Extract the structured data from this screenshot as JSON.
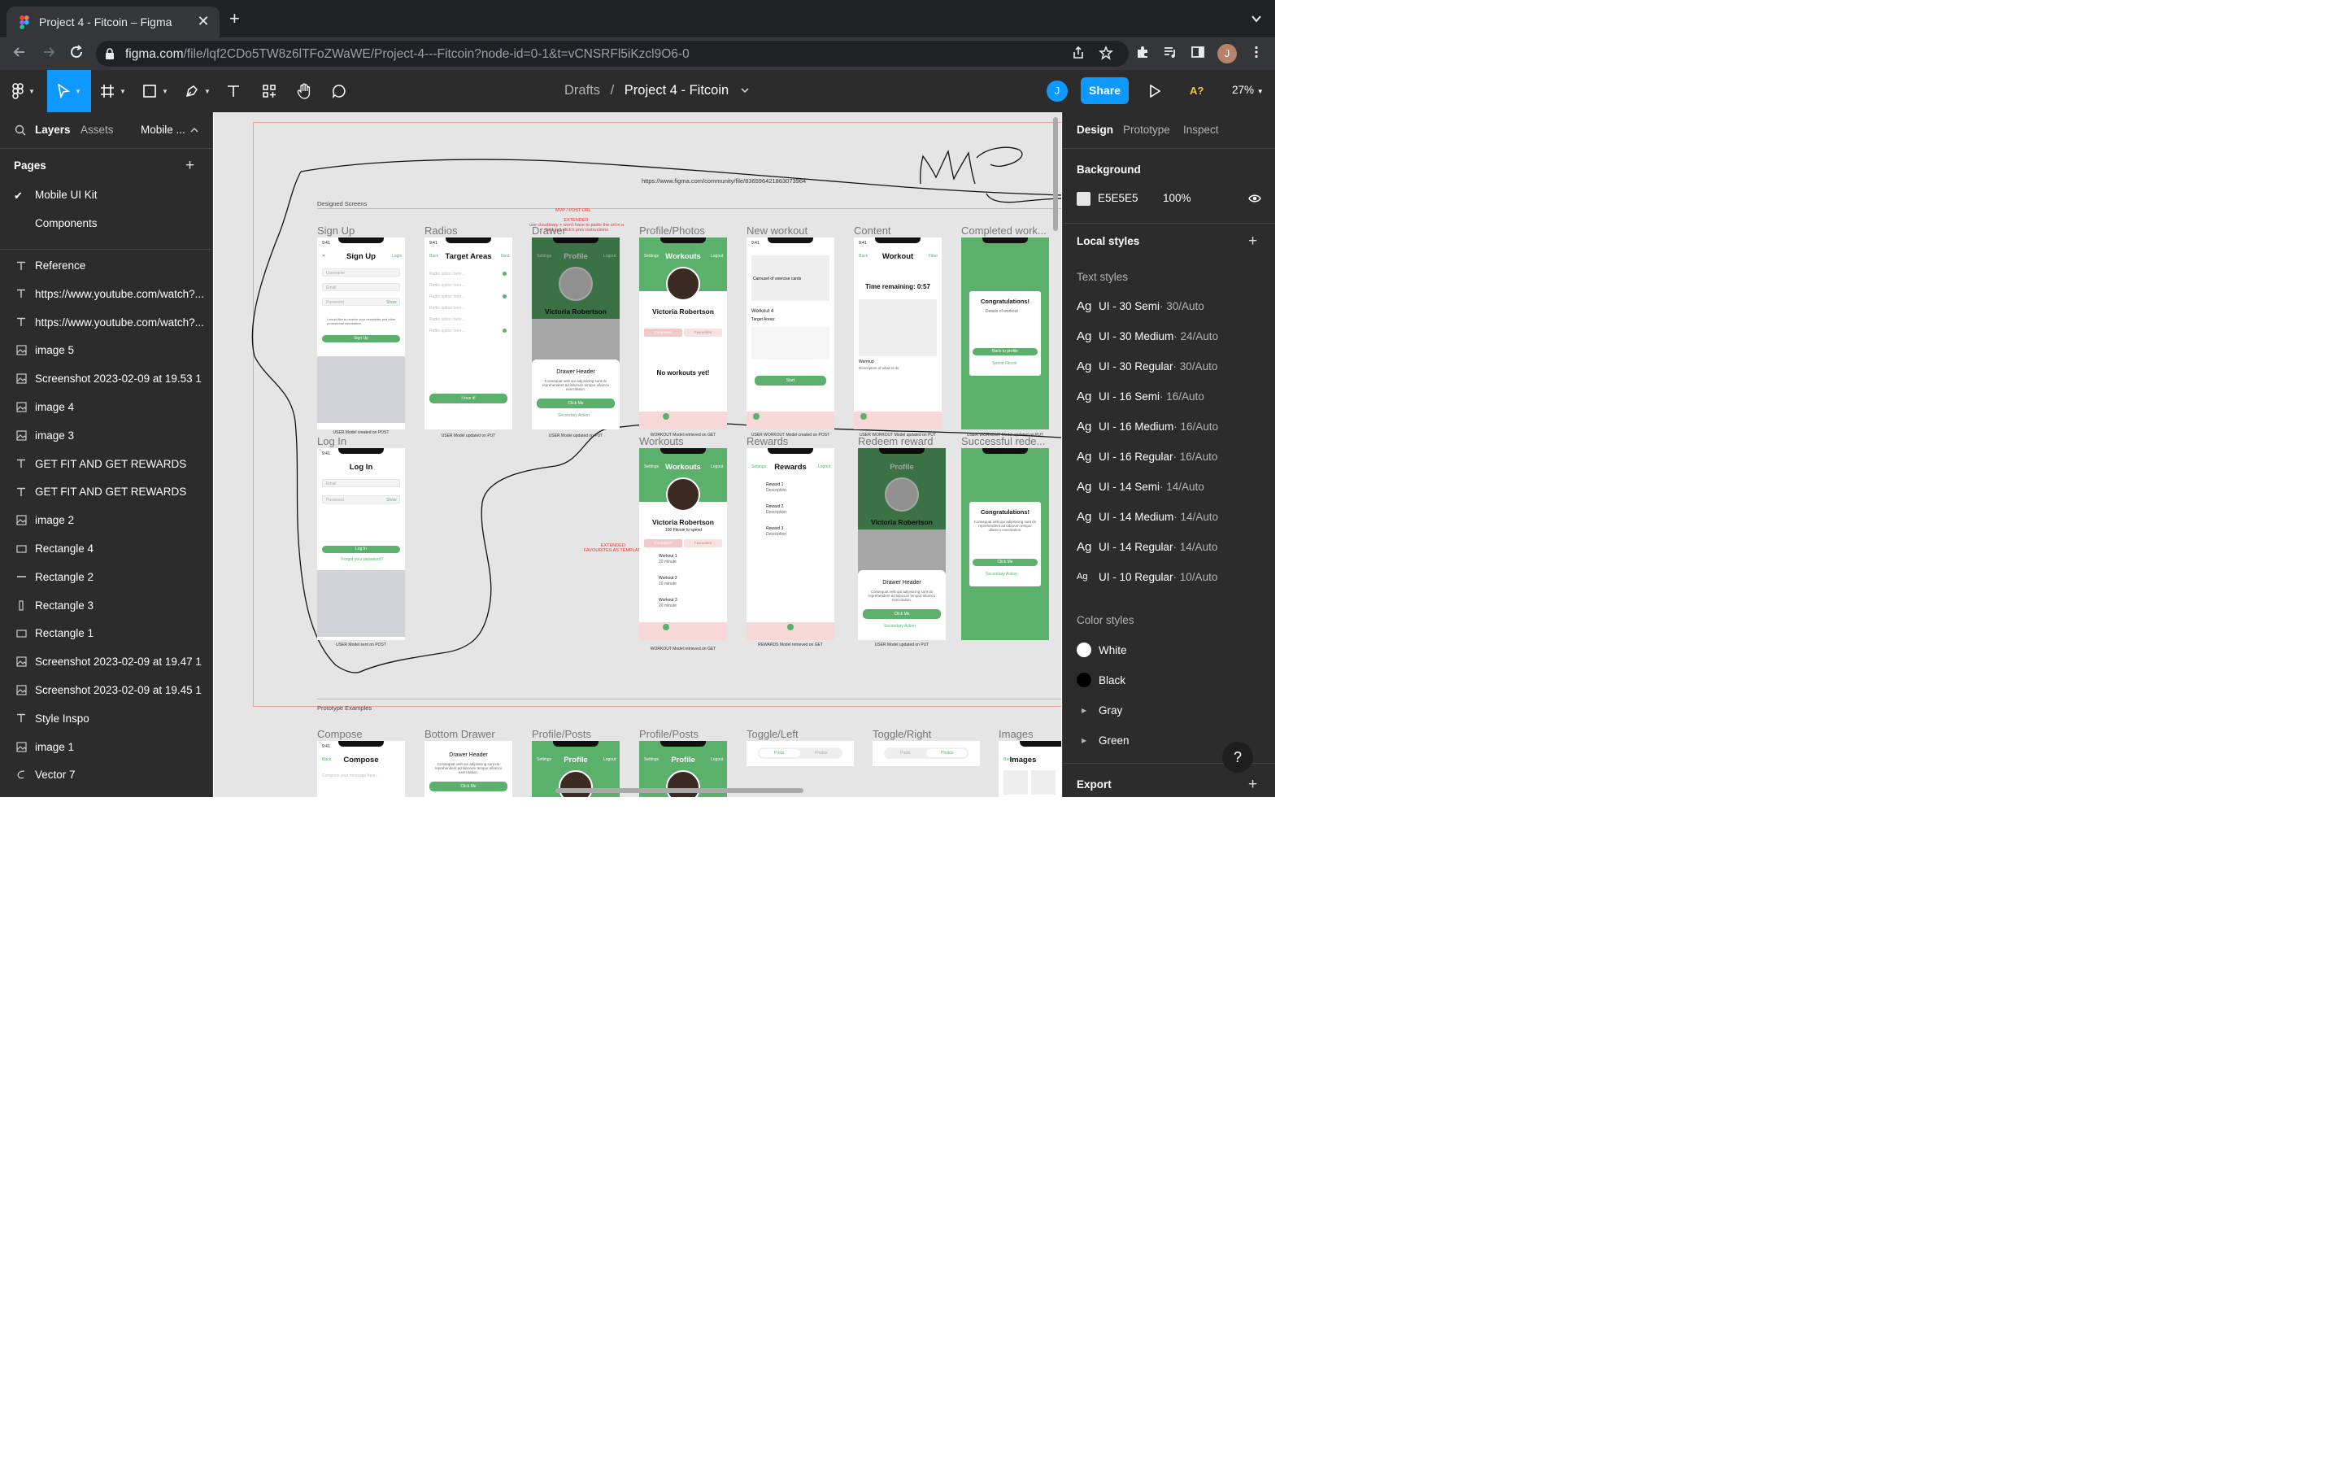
{
  "browser": {
    "tab_title": "Project 4 - Fitcoin – Figma",
    "tab_close": "✕",
    "new_tab": "+",
    "url_host": "figma.com",
    "url_path": "/file/lqf2CDo5TW8z6lTFoZWaWE/Project-4---Fitcoin?node-id=0-1&t=vCNSRFl5iKzcl9O6-0",
    "profile_initial": "J"
  },
  "toolbar": {
    "breadcrumb_drafts": "Drafts",
    "breadcrumb_sep": "/",
    "project_name": "Project 4 - Fitcoin",
    "user_initial": "J",
    "share_label": "Share",
    "a11y_label": "A?",
    "zoom_level": "27%"
  },
  "left_panel": {
    "tabs": [
      "Layers",
      "Assets",
      "Mobile ..."
    ],
    "pages_heading": "Pages",
    "pages": [
      "Mobile UI Kit",
      "Components"
    ],
    "layers": [
      {
        "icon": "text",
        "name": "Reference"
      },
      {
        "icon": "text",
        "name": "https://www.youtube.com/watch?..."
      },
      {
        "icon": "text",
        "name": "https://www.youtube.com/watch?..."
      },
      {
        "icon": "image",
        "name": "image 5"
      },
      {
        "icon": "image",
        "name": "Screenshot 2023-02-09 at 19.53 1"
      },
      {
        "icon": "image",
        "name": "image 4"
      },
      {
        "icon": "image",
        "name": "image 3"
      },
      {
        "icon": "text",
        "name": "GET FIT AND GET REWARDS"
      },
      {
        "icon": "text",
        "name": "GET FIT AND GET REWARDS"
      },
      {
        "icon": "image",
        "name": "image 2"
      },
      {
        "icon": "rect",
        "name": "Rectangle 4"
      },
      {
        "icon": "line",
        "name": "Rectangle 2"
      },
      {
        "icon": "vrect",
        "name": "Rectangle 3"
      },
      {
        "icon": "rect",
        "name": "Rectangle 1"
      },
      {
        "icon": "image",
        "name": "Screenshot 2023-02-09 at 19.47 1"
      },
      {
        "icon": "image",
        "name": "Screenshot 2023-02-09 at 19.45 1"
      },
      {
        "icon": "text",
        "name": "Style Inspo"
      },
      {
        "icon": "image",
        "name": "image 1"
      },
      {
        "icon": "vector",
        "name": "Vector 7"
      }
    ]
  },
  "canvas": {
    "mvp_scribble": "MVP",
    "community_url": "https://www.figma.com/community/file/836596421863073964",
    "designed_screens": "Designed Screens",
    "prototype_examples": "Prototype Examples",
    "red_note_1": "MVP / POST URL",
    "red_note_2": "EXTENDED:\nuse cloudinary + won't have to paste the url in a\nfield just click's prev instructions",
    "red_note_3": "EXTENDED:\nFAVOURITES AS TEMPLATE",
    "row1_labels": [
      "Sign Up",
      "Radios",
      "Drawer",
      "Profile/Photos",
      "New workout",
      "Content",
      "Completed work..."
    ],
    "row2_labels": [
      "Log In",
      "Workouts",
      "Rewards",
      "Redeem reward",
      "Successful rede..."
    ],
    "row3_labels": [
      "Compose",
      "Bottom Drawer",
      "Profile/Posts",
      "Profile/Posts",
      "Toggle/Left",
      "Toggle/Right",
      "Images"
    ],
    "captions": {
      "signup": "USER Model created on POST",
      "radios": "USER Model updated on PUT",
      "drawer": "USER Model updated on PUT",
      "profile": "WORKOUT Model retrieved on GET",
      "newworkout": "USER WORKOUT Model created on POST",
      "content": "USER WORKOUT Model updated on PUT",
      "completed": "USER WORKOUT Model updated on PUT",
      "login": "USER Model sent on POST",
      "workouts": "WORKOUT Model retrieved on GET",
      "rewards": "REWARDS Model retrieved on GET",
      "redeem": "USER Model updated on PUT"
    },
    "screens": {
      "status_time": "9:41",
      "signup_title": "Sign Up",
      "signup_login": "Login",
      "signup_fields": [
        "Username",
        "Email",
        "Password"
      ],
      "signup_show": "Show",
      "signup_check": "I would like to receive your newsletter and other promotional information.",
      "signup_btn": "Sign Up",
      "radios_title": "Target Areas",
      "radios_back": "Back",
      "radios_next": "Next",
      "radio_option": "Radio option here...",
      "radios_btn": "I love it!",
      "profile_title": "Profile",
      "settings": "Settings",
      "logout": "Logout",
      "person_name": "Victoria Robertson",
      "drawer_header": "Drawer Header",
      "drawer_text": "Consequat velit qui adipisicing sunt do reprehenderit ad laborum tempor ullamco exercitation.",
      "click_me": "Click Me",
      "secondary_action": "Secondary Action",
      "workouts_title": "Workouts",
      "completed_tab": "Completed",
      "favourites_tab": "Favourites",
      "no_workouts": "No workouts yet!",
      "carousel": "Carousel of exercise cards",
      "workout_4": "Workout 4",
      "target_areas": "Target Areas:",
      "start": "Start",
      "content_title": "Workout",
      "content_back": "Back",
      "content_filter": "Filter",
      "time_remaining": "Time remaining: 0:57",
      "warmup": "Warmup",
      "warmup_desc": "Description of what to do",
      "congrats": "Congratulations!",
      "details": "Details of workout",
      "back_to_profile": "Back to profile",
      "spend_fitcoin": "Spend Fitcoin",
      "login_title": "Log In",
      "login_fields": [
        "Email",
        "Password"
      ],
      "login_btn": "Log In",
      "forgot": "Forgot your password?",
      "fitcoin_spend": "100 Fitcoin to spend",
      "workout_items": [
        "Workout 1",
        "Workout 2",
        "Workout 3"
      ],
      "workout_mins": [
        "20 minute",
        "10 minute",
        "20 minute"
      ],
      "rewards_title": "Rewards",
      "reward_items": [
        "Reward 1",
        "Reward 2",
        "Reward 3"
      ],
      "reward_desc": "Description",
      "reward_cost": "50 Fitcoin",
      "compose_title": "Compose",
      "compose_back": "Back",
      "compose_placeholder": "Compose your message here...",
      "images_title": "Images",
      "toggle_posts": "Posts",
      "toggle_photos": "Photos"
    }
  },
  "right_panel": {
    "tabs": [
      "Design",
      "Prototype",
      "Inspect"
    ],
    "background_heading": "Background",
    "bg_hex": "E5E5E5",
    "bg_opacity": "100%",
    "local_styles": "Local styles",
    "text_styles_heading": "Text styles",
    "ag": "Ag",
    "text_styles": [
      {
        "name": "UI - 30 Semi",
        "meta": " · 30/Auto"
      },
      {
        "name": "UI - 30 Medium",
        "meta": " · 24/Auto"
      },
      {
        "name": "UI - 30 Regular",
        "meta": " · 30/Auto"
      },
      {
        "name": "UI - 16 Semi",
        "meta": " · 16/Auto"
      },
      {
        "name": "UI - 16 Medium",
        "meta": " · 16/Auto"
      },
      {
        "name": "UI - 16 Regular",
        "meta": " · 16/Auto"
      },
      {
        "name": "UI - 14 Semi",
        "meta": " · 14/Auto"
      },
      {
        "name": "UI - 14 Medium",
        "meta": " · 14/Auto"
      },
      {
        "name": "UI - 14 Regular",
        "meta": " · 14/Auto"
      },
      {
        "name": "UI - 10 Regular",
        "meta": " · 10/Auto"
      }
    ],
    "color_styles_heading": "Color styles",
    "color_styles": [
      {
        "name": "White",
        "hex": "#ffffff"
      },
      {
        "name": "Black",
        "hex": "#000000"
      },
      {
        "name": "Gray",
        "hex": ""
      },
      {
        "name": "Green",
        "hex": ""
      }
    ],
    "export_heading": "Export",
    "help": "?"
  },
  "colors": {
    "figma_blue": "#0d99ff",
    "panel_bg": "#2c2c2c",
    "canvas_bg": "#e5e5e5",
    "app_green": "#5bb06b"
  }
}
